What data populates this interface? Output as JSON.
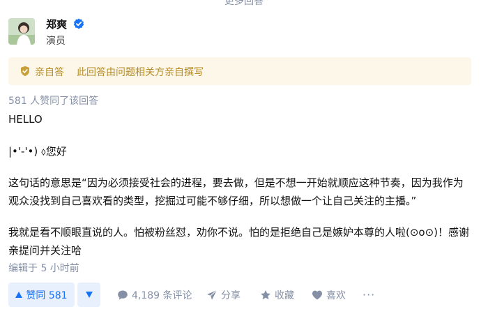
{
  "top_hint": "更多回答",
  "author": {
    "name": "郑爽",
    "title": "演员"
  },
  "notice": {
    "title": "亲自答",
    "text": "此回答由问题相关方亲自撰写"
  },
  "likes_line": "581 人赞同了该回答",
  "content": {
    "p1": "HELLO",
    "p2": "|•'-'•) ⬨您好",
    "p3": "这句话的意思是“因为必须接受社会的进程，要去做，但是不想一开始就顺应这种节奏，因为我作为观众没找到自己喜欢看的类型，挖掘过可能不够仔细，所以想做一个让自己关注的主播。”",
    "p4": "我就是看不顺眼直说的人。怕被粉丝怼，劝你不说。怕的是拒绝自己是嫉妒本尊的人啦(⊙o⊙)！感谢亲提问并关注哈"
  },
  "edited": "编辑于 5 小时前",
  "actions": {
    "vote_up": "赞同 581",
    "comments": "4,189 条评论",
    "share": "分享",
    "favorite": "收藏",
    "like": "喜欢",
    "more": "···"
  },
  "colors": {
    "brand_blue": "#1772f6",
    "vote_bg": "#e8f0fe",
    "notice_bg": "#fdf7ea",
    "notice_text": "#b48c28",
    "muted": "#8590a6"
  },
  "icons": {
    "verified": "verified-badge-icon",
    "notice": "shield-badge-icon",
    "vote_up": "triangle-up-icon",
    "vote_down": "triangle-down-icon",
    "comment": "comment-bubble-icon",
    "share": "paper-plane-icon",
    "favorite": "star-icon",
    "like": "heart-icon"
  }
}
